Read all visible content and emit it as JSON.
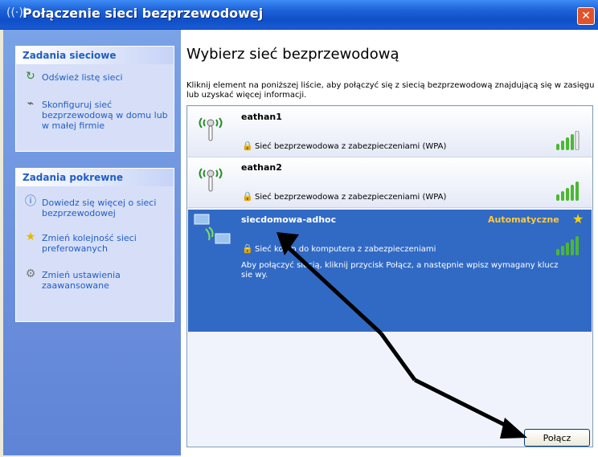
{
  "window": {
    "title": "Połączenie sieci bezprzewodowej",
    "title_icon": "wireless-signal-icon",
    "close_label": "✕"
  },
  "left_pane": {
    "network_tasks": {
      "header": "Zadania sieciowe",
      "items": [
        {
          "label": "Odśwież listę sieci",
          "icon": "refresh-icon"
        },
        {
          "label": "Skonfiguruj sieć bezprzewodową w domu lub w małej firmie",
          "icon": "network-setup-icon"
        }
      ]
    },
    "related_tasks": {
      "header": "Zadania pokrewne",
      "items": [
        {
          "label": "Dowiedz się więcej o sieci bezprzewodowej",
          "icon": "info-icon"
        },
        {
          "label": "Zmień kolejność sieci preferowanych",
          "icon": "star-icon"
        },
        {
          "label": "Zmień ustawienia zaawansowane",
          "icon": "settings-icon"
        }
      ]
    }
  },
  "main": {
    "title": "Wybierz sieć bezprzewodową",
    "instructions": "Kliknij element na poniższej liście, aby połączyć się z siecią bezprzewodową znajdującą się w zasięgu lub uzyskać więcej informacji.",
    "networks": [
      {
        "name": "eathan1",
        "security": "Sieć bezprzewodowa z zabezpieczeniami (WPA)",
        "signal_bars": 4,
        "selected": false
      },
      {
        "name": "eathan2",
        "security": "Sieć bezprzewodowa z zabezpieczeniami (WPA)",
        "signal_bars": 5,
        "selected": false
      },
      {
        "name": "siecdomowa-adhoc",
        "security": "Sieć komp    do komputera z zabezpieczeniami",
        "status": "Automatyczne",
        "signal_bars": 5,
        "selected": true,
        "details": "Aby połączyć     siecią, kliknij przycisk Połącz, a następnie wpisz wymagany klucz sie    wy."
      }
    ],
    "connect_button": "Połącz"
  },
  "colors": {
    "title_bar": "#1e62d8",
    "left_pane": "#6b8fdc",
    "task_text": "#215dc6",
    "selection": "#316ac5",
    "signal_green": "#4cb832",
    "signal_empty": "#f2f2f2",
    "status_yellow": "#ffc93b"
  }
}
